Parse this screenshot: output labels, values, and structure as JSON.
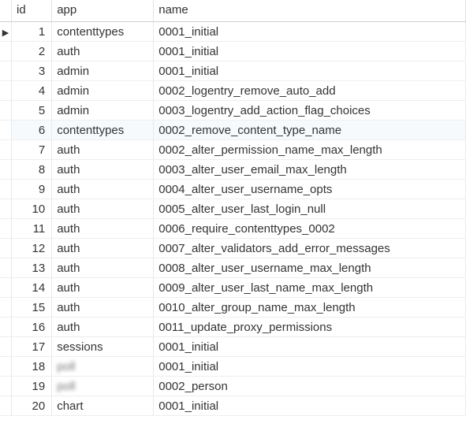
{
  "columns": {
    "id": "id",
    "app": "app",
    "name": "name"
  },
  "rows": [
    {
      "id": "1",
      "app": "contenttypes",
      "name": "0001_initial",
      "selected": true
    },
    {
      "id": "2",
      "app": "auth",
      "name": "0001_initial"
    },
    {
      "id": "3",
      "app": "admin",
      "name": "0001_initial"
    },
    {
      "id": "4",
      "app": "admin",
      "name": "0002_logentry_remove_auto_add"
    },
    {
      "id": "5",
      "app": "admin",
      "name": "0003_logentry_add_action_flag_choices"
    },
    {
      "id": "6",
      "app": "contenttypes",
      "name": "0002_remove_content_type_name",
      "alt": true
    },
    {
      "id": "7",
      "app": "auth",
      "name": "0002_alter_permission_name_max_length"
    },
    {
      "id": "8",
      "app": "auth",
      "name": "0003_alter_user_email_max_length"
    },
    {
      "id": "9",
      "app": "auth",
      "name": "0004_alter_user_username_opts"
    },
    {
      "id": "10",
      "app": "auth",
      "name": "0005_alter_user_last_login_null"
    },
    {
      "id": "11",
      "app": "auth",
      "name": "0006_require_contenttypes_0002"
    },
    {
      "id": "12",
      "app": "auth",
      "name": "0007_alter_validators_add_error_messages"
    },
    {
      "id": "13",
      "app": "auth",
      "name": "0008_alter_user_username_max_length"
    },
    {
      "id": "14",
      "app": "auth",
      "name": "0009_alter_user_last_name_max_length"
    },
    {
      "id": "15",
      "app": "auth",
      "name": "0010_alter_group_name_max_length"
    },
    {
      "id": "16",
      "app": "auth",
      "name": "0011_update_proxy_permissions"
    },
    {
      "id": "17",
      "app": "sessions",
      "name": "0001_initial"
    },
    {
      "id": "18",
      "app": "poll",
      "name": "0001_initial",
      "obscured": true
    },
    {
      "id": "19",
      "app": "poll",
      "name": "0002_person",
      "obscured": true
    },
    {
      "id": "20",
      "app": "chart",
      "name": "0001_initial"
    }
  ],
  "indicator_glyph": "▶"
}
